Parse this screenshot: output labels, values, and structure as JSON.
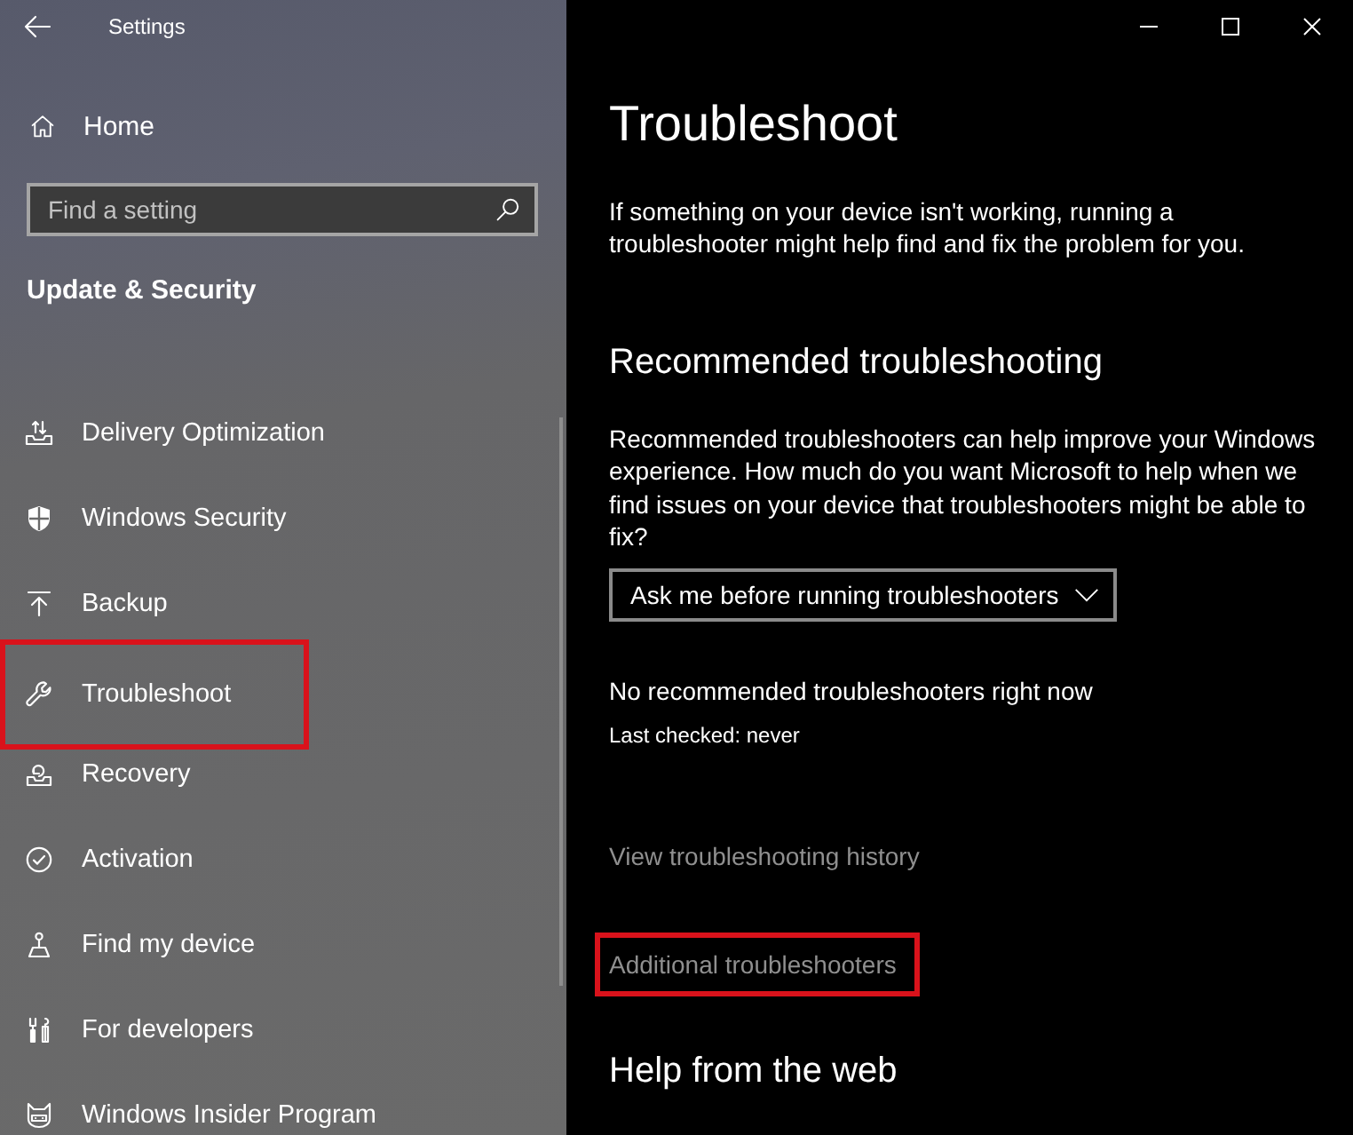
{
  "window": {
    "title": "Settings"
  },
  "sidebar": {
    "home": "Home",
    "search": {
      "placeholder": "Find a setting"
    },
    "section_title": "Update & Security",
    "items": [
      {
        "label": "Delivery Optimization",
        "highlighted": false
      },
      {
        "label": "Windows Security",
        "highlighted": false
      },
      {
        "label": "Backup",
        "highlighted": false
      },
      {
        "label": "Troubleshoot",
        "highlighted": true
      },
      {
        "label": "Recovery",
        "highlighted": false
      },
      {
        "label": "Activation",
        "highlighted": false
      },
      {
        "label": "Find my device",
        "highlighted": false
      },
      {
        "label": "For developers",
        "highlighted": false
      },
      {
        "label": "Windows Insider Program",
        "highlighted": false
      }
    ]
  },
  "main": {
    "title": "Troubleshoot",
    "intro": "If something on your device isn't working, running a troubleshooter might help find and fix the problem for you.",
    "recommended": {
      "heading": "Recommended troubleshooting",
      "description": "Recommended troubleshooters can help improve your Windows experience. How much do you want Microsoft to help when we find issues on your device that troubleshooters might be able to fix?",
      "dropdown": {
        "value": "Ask me before running troubleshooters"
      },
      "status": "No recommended troubleshooters right now",
      "last_checked": "Last checked: never"
    },
    "links": [
      {
        "label": "View troubleshooting history",
        "highlighted": false
      },
      {
        "label": "Additional troubleshooters",
        "highlighted": true
      }
    ],
    "help_heading": "Help from the web"
  }
}
